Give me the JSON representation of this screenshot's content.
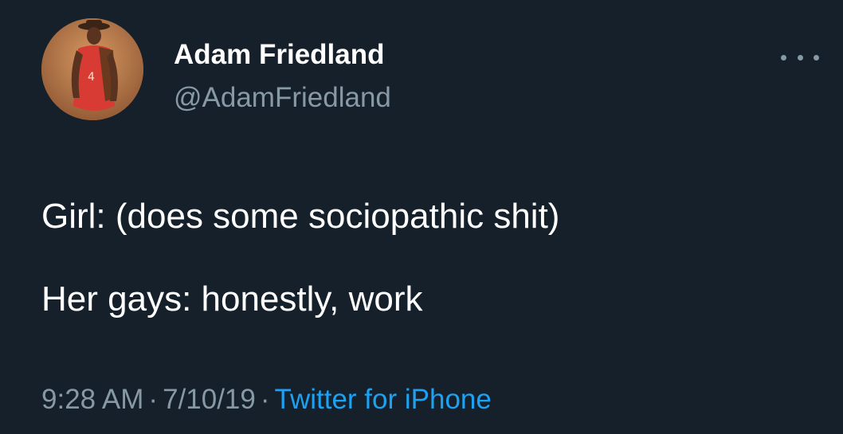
{
  "tweet": {
    "author": {
      "display_name": "Adam Friedland",
      "handle": "@AdamFriedland"
    },
    "body": [
      "Girl: (does some sociopathic shit)",
      "Her gays: honestly, work"
    ],
    "meta": {
      "time": "9:28 AM",
      "separator": "·",
      "date": "7/10/19",
      "source": "Twitter for iPhone"
    },
    "more_icon": "more-horizontal-icon"
  },
  "colors": {
    "background": "#15202b",
    "primary_text": "#ffffff",
    "secondary_text": "#8899a6",
    "link": "#1da1f2"
  }
}
